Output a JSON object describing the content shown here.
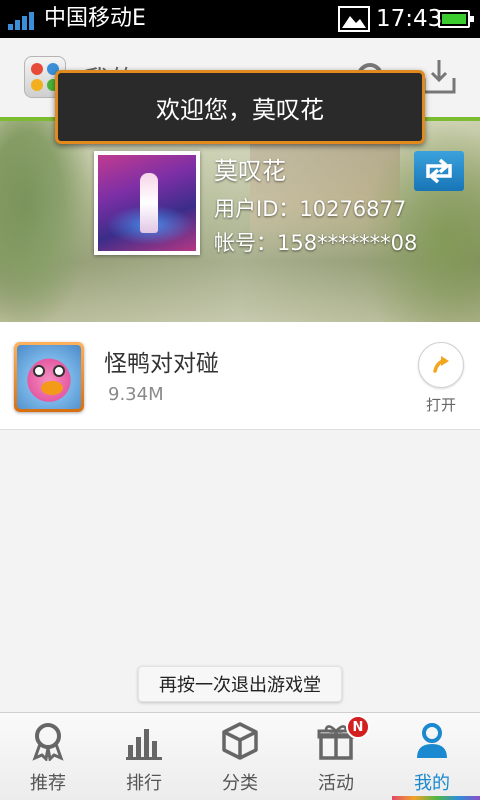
{
  "status_bar": {
    "carrier": "中国移动E",
    "time": "17:43",
    "battery_color": "#3ccb2e",
    "signal_color": "#3a8fd8"
  },
  "header": {
    "title": "我的",
    "settings_icon": "gear-icon",
    "download_icon": "download-icon",
    "accent_line_color": "#7dbb31"
  },
  "welcome_toast": {
    "text": "欢迎您，莫叹花"
  },
  "profile": {
    "name": "莫叹花",
    "user_id": "用户ID：10276877",
    "account": "帐号：158*******08",
    "switch_icon": "switch-arrows-icon"
  },
  "games": [
    {
      "name": "怪鸭对对碰",
      "size": "9.34M",
      "action_label": "打开"
    }
  ],
  "exit_toast": {
    "text": "再按一次退出游戏堂"
  },
  "bottom_nav": {
    "items": [
      {
        "label": "推荐",
        "icon": "award-ribbon-icon"
      },
      {
        "label": "排行",
        "icon": "bar-chart-icon"
      },
      {
        "label": "分类",
        "icon": "cube-icon"
      },
      {
        "label": "活动",
        "icon": "gift-icon",
        "badge": "N"
      },
      {
        "label": "我的",
        "icon": "user-icon",
        "active": true
      }
    ],
    "active_color": "#1a89cf"
  }
}
